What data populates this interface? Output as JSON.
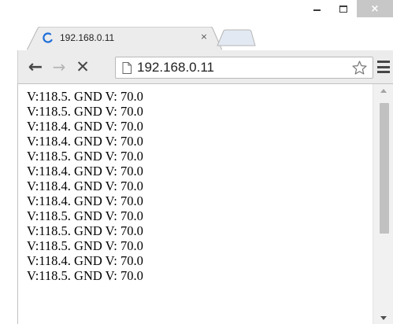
{
  "window": {
    "controls": {
      "minimize": "minimize",
      "maximize": "maximize",
      "close": "×"
    }
  },
  "tabs": [
    {
      "title": "192.168.0.11",
      "close_label": "×",
      "favicon": "loading-spinner-icon",
      "accent": "#1e6fd9"
    }
  ],
  "toolbar": {
    "back_icon": "←",
    "forward_icon": "→",
    "stop_icon": "✕",
    "url": "192.168.0.11"
  },
  "content": {
    "lines": [
      "V:118.5. GND V: 70.0",
      "V:118.5. GND V: 70.0",
      "V:118.4. GND V: 70.0",
      "V:118.4. GND V: 70.0",
      "V:118.5. GND V: 70.0",
      "V:118.4. GND V: 70.0",
      "V:118.4. GND V: 70.0",
      "V:118.4. GND V: 70.0",
      "V:118.5. GND V: 70.0",
      "V:118.5. GND V: 70.0",
      "V:118.5. GND V: 70.0",
      "V:118.4. GND V: 70.0",
      "V:118.5. GND V: 70.0"
    ]
  },
  "colors": {
    "toolbar_bg": "#ececec",
    "close_btn_bg": "#c7c7c7",
    "scroll_thumb": "#c1c1c1"
  }
}
